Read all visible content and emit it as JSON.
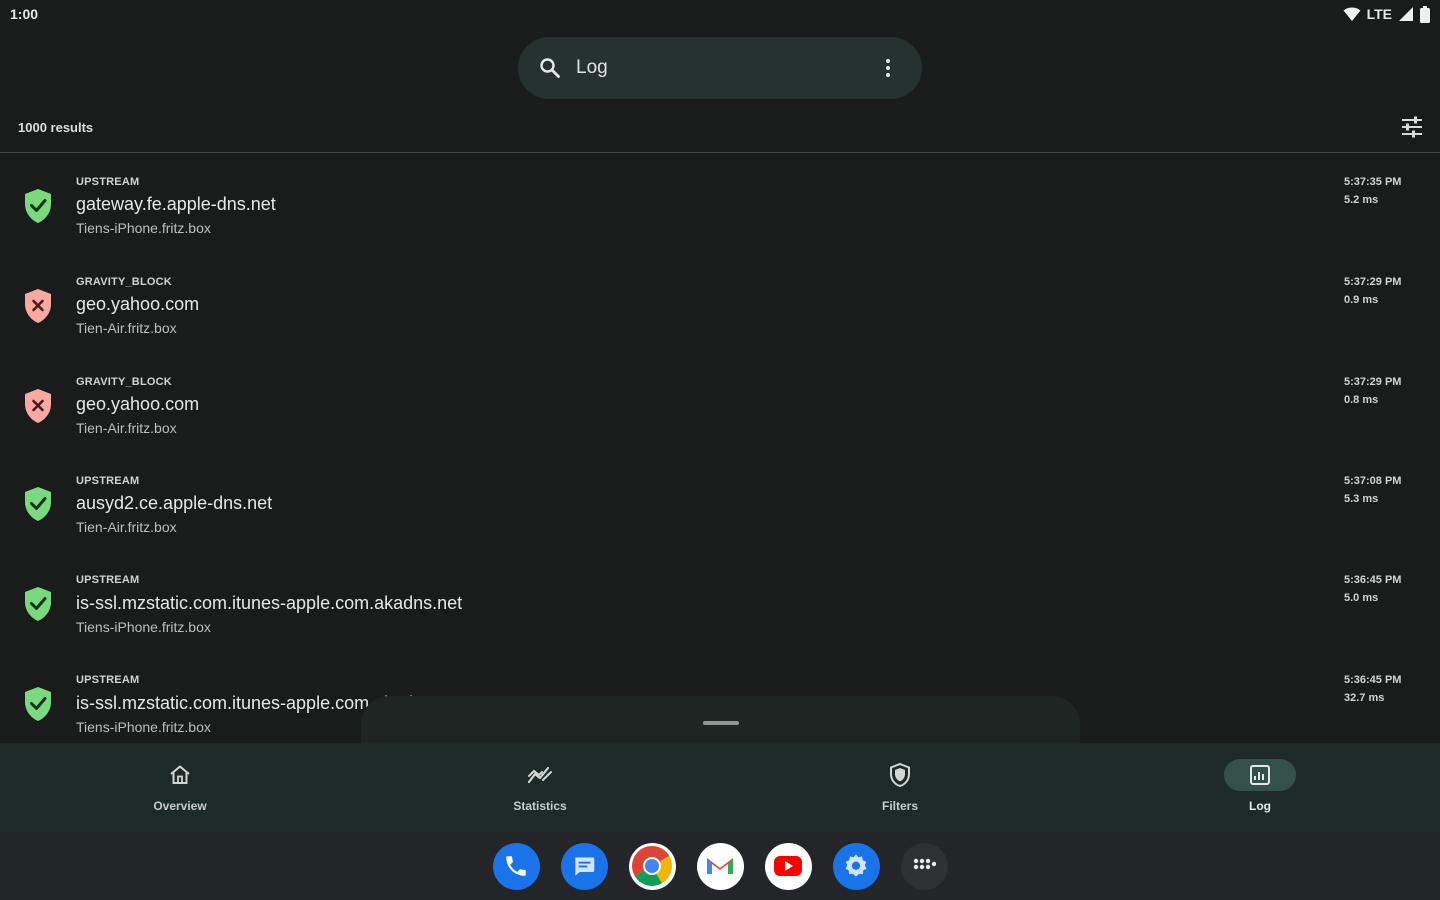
{
  "status_bar": {
    "time": "1:00",
    "network": "LTE"
  },
  "search": {
    "placeholder": "Log"
  },
  "results": {
    "count_label": "1000 results"
  },
  "log_entries": [
    {
      "status": "UPSTREAM",
      "domain": "gateway.fe.apple-dns.net",
      "client": "Tiens-iPhone.fritz.box",
      "time": "5:37:35 PM",
      "duration": "5.2 ms",
      "blocked": false
    },
    {
      "status": "GRAVITY_BLOCK",
      "domain": "geo.yahoo.com",
      "client": "Tien-Air.fritz.box",
      "time": "5:37:29 PM",
      "duration": "0.9 ms",
      "blocked": true
    },
    {
      "status": "GRAVITY_BLOCK",
      "domain": "geo.yahoo.com",
      "client": "Tien-Air.fritz.box",
      "time": "5:37:29 PM",
      "duration": "0.8 ms",
      "blocked": true
    },
    {
      "status": "UPSTREAM",
      "domain": "ausyd2.ce.apple-dns.net",
      "client": "Tien-Air.fritz.box",
      "time": "5:37:08 PM",
      "duration": "5.3 ms",
      "blocked": false
    },
    {
      "status": "UPSTREAM",
      "domain": "is-ssl.mzstatic.com.itunes-apple.com.akadns.net",
      "client": "Tiens-iPhone.fritz.box",
      "time": "5:36:45 PM",
      "duration": "5.0 ms",
      "blocked": false
    },
    {
      "status": "UPSTREAM",
      "domain": "is-ssl.mzstatic.com.itunes-apple.com.akadns.net",
      "client": "Tiens-iPhone.fritz.box",
      "time": "5:36:45 PM",
      "duration": "32.7 ms",
      "blocked": false
    }
  ],
  "nav": {
    "items": [
      {
        "label": "Overview",
        "icon": "home-icon"
      },
      {
        "label": "Statistics",
        "icon": "chart-icon"
      },
      {
        "label": "Filters",
        "icon": "shield-icon"
      },
      {
        "label": "Log",
        "icon": "log-icon",
        "active": true
      }
    ]
  },
  "dock": {
    "apps": [
      {
        "icon": "phone-icon"
      },
      {
        "icon": "messages-icon"
      },
      {
        "icon": "chrome-icon"
      },
      {
        "icon": "gmail-icon"
      },
      {
        "icon": "youtube-icon"
      },
      {
        "icon": "settings-icon"
      },
      {
        "icon": "app-grid-icon"
      }
    ]
  },
  "colors": {
    "allowed_shield": "#7ad97e",
    "blocked_shield": "#f7a9a2",
    "background": "#191c1b",
    "nav_background": "#1d2a28",
    "active_nav": "#33504a"
  }
}
